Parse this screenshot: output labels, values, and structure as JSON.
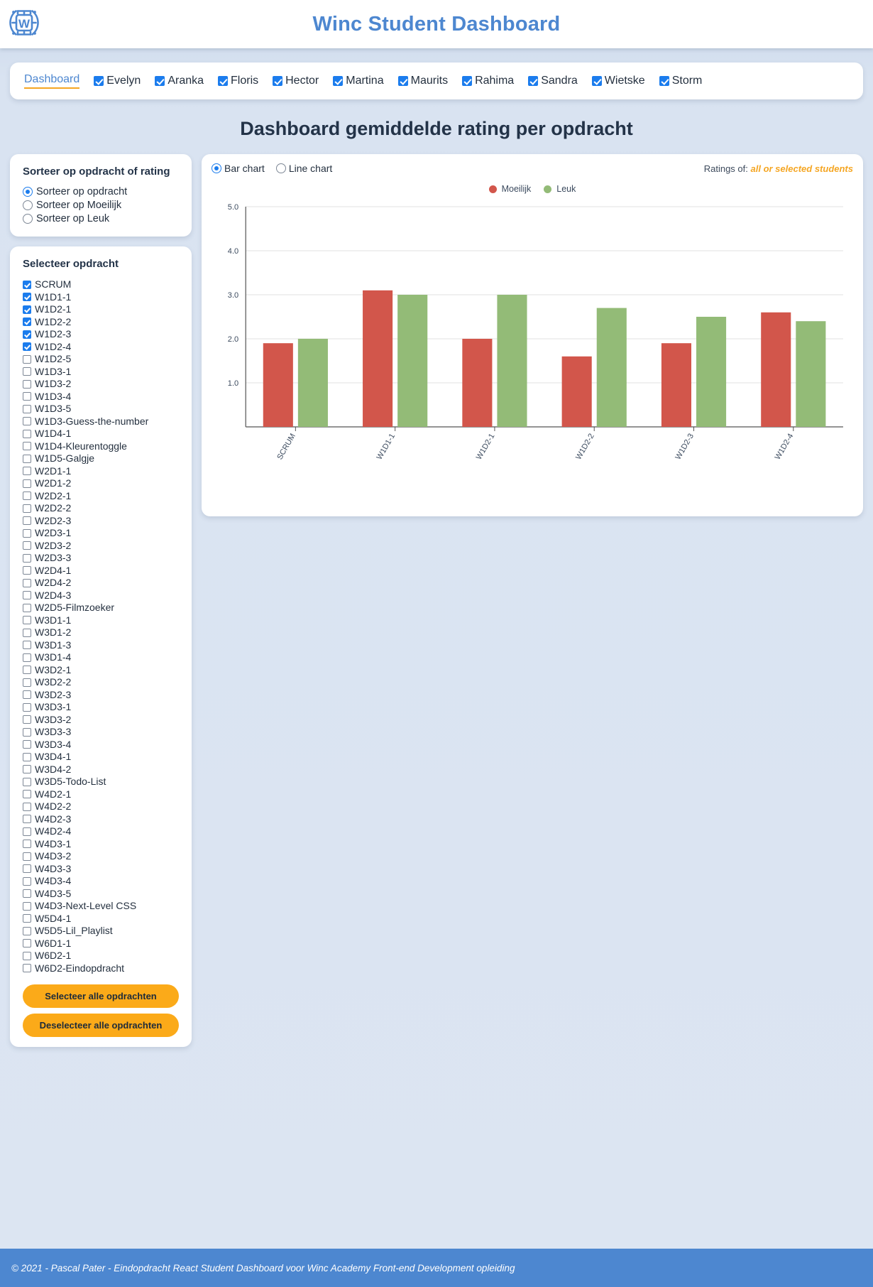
{
  "header": {
    "title": "Winc Student Dashboard",
    "logo_icon": "winc-circuit-w-logo",
    "brand_color": "#4d87d0"
  },
  "nav": {
    "dashboard_link": "Dashboard",
    "students": [
      {
        "name": "Evelyn",
        "checked": true
      },
      {
        "name": "Aranka",
        "checked": true
      },
      {
        "name": "Floris",
        "checked": true
      },
      {
        "name": "Hector",
        "checked": true
      },
      {
        "name": "Martina",
        "checked": true
      },
      {
        "name": "Maurits",
        "checked": true
      },
      {
        "name": "Rahima",
        "checked": true
      },
      {
        "name": "Sandra",
        "checked": true
      },
      {
        "name": "Wietske",
        "checked": true
      },
      {
        "name": "Storm",
        "checked": true
      }
    ]
  },
  "page_title": "Dashboard gemiddelde rating per opdracht",
  "sort_panel": {
    "heading": "Sorteer op opdracht of rating",
    "options": [
      {
        "label": "Sorteer op opdracht",
        "selected": true
      },
      {
        "label": "Sorteer op Moeilijk",
        "selected": false
      },
      {
        "label": "Sorteer op Leuk",
        "selected": false
      }
    ]
  },
  "assignment_panel": {
    "heading": "Selecteer opdracht",
    "select_all_label": "Selecteer alle opdrachten",
    "deselect_all_label": "Deselecteer alle opdrachten",
    "items": [
      {
        "label": "SCRUM",
        "checked": true
      },
      {
        "label": "W1D1-1",
        "checked": true
      },
      {
        "label": "W1D2-1",
        "checked": true
      },
      {
        "label": "W1D2-2",
        "checked": true
      },
      {
        "label": "W1D2-3",
        "checked": true
      },
      {
        "label": "W1D2-4",
        "checked": true
      },
      {
        "label": "W1D2-5",
        "checked": false
      },
      {
        "label": "W1D3-1",
        "checked": false
      },
      {
        "label": "W1D3-2",
        "checked": false
      },
      {
        "label": "W1D3-4",
        "checked": false
      },
      {
        "label": "W1D3-5",
        "checked": false
      },
      {
        "label": "W1D3-Guess-the-number",
        "checked": false
      },
      {
        "label": "W1D4-1",
        "checked": false
      },
      {
        "label": "W1D4-Kleurentoggle",
        "checked": false
      },
      {
        "label": "W1D5-Galgje",
        "checked": false
      },
      {
        "label": "W2D1-1",
        "checked": false
      },
      {
        "label": "W2D1-2",
        "checked": false
      },
      {
        "label": "W2D2-1",
        "checked": false
      },
      {
        "label": "W2D2-2",
        "checked": false
      },
      {
        "label": "W2D2-3",
        "checked": false
      },
      {
        "label": "W2D3-1",
        "checked": false
      },
      {
        "label": "W2D3-2",
        "checked": false
      },
      {
        "label": "W2D3-3",
        "checked": false
      },
      {
        "label": "W2D4-1",
        "checked": false
      },
      {
        "label": "W2D4-2",
        "checked": false
      },
      {
        "label": "W2D4-3",
        "checked": false
      },
      {
        "label": "W2D5-Filmzoeker",
        "checked": false
      },
      {
        "label": "W3D1-1",
        "checked": false
      },
      {
        "label": "W3D1-2",
        "checked": false
      },
      {
        "label": "W3D1-3",
        "checked": false
      },
      {
        "label": "W3D1-4",
        "checked": false
      },
      {
        "label": "W3D2-1",
        "checked": false
      },
      {
        "label": "W3D2-2",
        "checked": false
      },
      {
        "label": "W3D2-3",
        "checked": false
      },
      {
        "label": "W3D3-1",
        "checked": false
      },
      {
        "label": "W3D3-2",
        "checked": false
      },
      {
        "label": "W3D3-3",
        "checked": false
      },
      {
        "label": "W3D3-4",
        "checked": false
      },
      {
        "label": "W3D4-1",
        "checked": false
      },
      {
        "label": "W3D4-2",
        "checked": false
      },
      {
        "label": "W3D5-Todo-List",
        "checked": false
      },
      {
        "label": "W4D2-1",
        "checked": false
      },
      {
        "label": "W4D2-2",
        "checked": false
      },
      {
        "label": "W4D2-3",
        "checked": false
      },
      {
        "label": "W4D2-4",
        "checked": false
      },
      {
        "label": "W4D3-1",
        "checked": false
      },
      {
        "label": "W4D3-2",
        "checked": false
      },
      {
        "label": "W4D3-3",
        "checked": false
      },
      {
        "label": "W4D3-4",
        "checked": false
      },
      {
        "label": "W4D3-5",
        "checked": false
      },
      {
        "label": "W4D3-Next-Level CSS",
        "checked": false
      },
      {
        "label": "W5D4-1",
        "checked": false
      },
      {
        "label": "W5D5-Lil_Playlist",
        "checked": false
      },
      {
        "label": "W6D1-1",
        "checked": false
      },
      {
        "label": "W6D2-1",
        "checked": false
      },
      {
        "label": "W6D2-Eindopdracht",
        "checked": false
      }
    ]
  },
  "chart_panel": {
    "chart_type_options": [
      {
        "label": "Bar chart",
        "selected": true
      },
      {
        "label": "Line chart",
        "selected": false
      }
    ],
    "ratings_of_label": "Ratings of:",
    "ratings_of_value": "all or selected students"
  },
  "chart_data": {
    "type": "bar",
    "title": "",
    "xlabel": "",
    "ylabel": "",
    "ylim": [
      0,
      5.0
    ],
    "yticks": [
      1.0,
      2.0,
      3.0,
      4.0,
      5.0
    ],
    "ytick_labels": [
      "1.0",
      "2.0",
      "3.0",
      "4.0",
      "5.0"
    ],
    "grid": true,
    "legend_position": "top-center",
    "categories": [
      "SCRUM",
      "W1D1-1",
      "W1D2-1",
      "W1D2-2",
      "W1D2-3",
      "W1D2-4"
    ],
    "series": [
      {
        "name": "Moeilijk",
        "color": "#d2564b",
        "values": [
          1.9,
          3.1,
          2.0,
          1.6,
          1.9,
          2.6
        ]
      },
      {
        "name": "Leuk",
        "color": "#93bb77",
        "values": [
          2.0,
          3.0,
          3.0,
          2.7,
          2.5,
          2.4
        ]
      }
    ]
  },
  "footer": {
    "text": "© 2021 - Pascal Pater - Eindopdracht React Student Dashboard voor Winc Academy Front-end Development opleiding"
  }
}
